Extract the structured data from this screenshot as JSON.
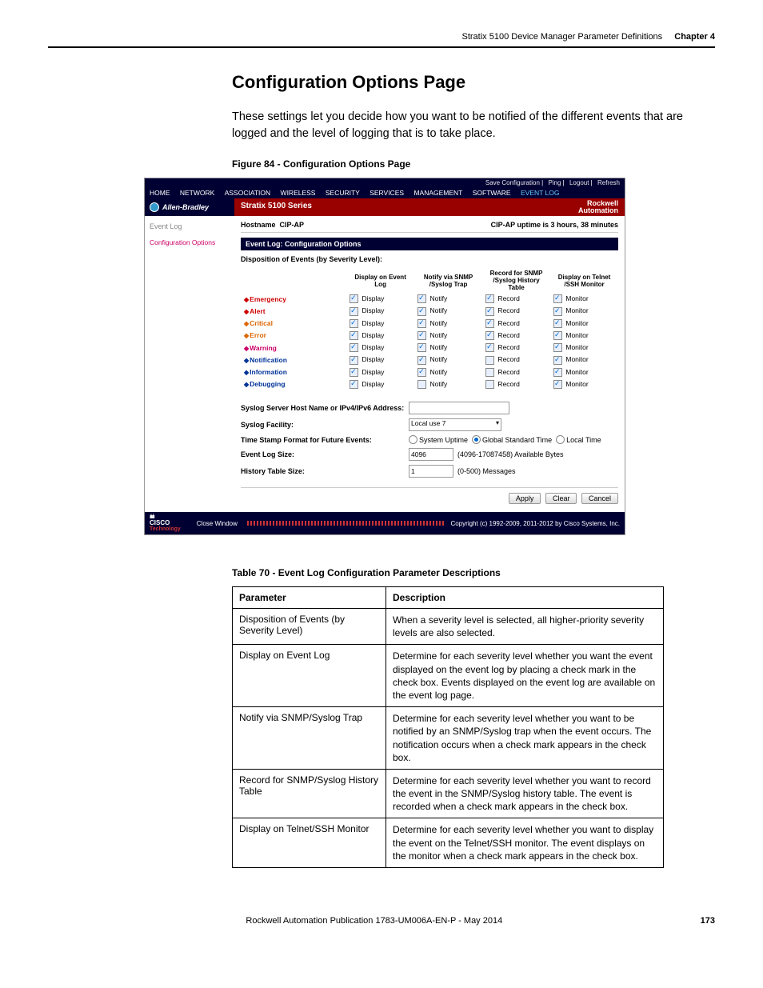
{
  "header": {
    "doc_section": "Stratix 5100 Device Manager Parameter Definitions",
    "chapter": "Chapter 4"
  },
  "section": {
    "title": "Configuration Options Page",
    "body": "These settings let you decide how you want to be notified of the different events that are logged and the level of logging that is to take place.",
    "figure_caption": "Figure 84 - Configuration Options Page",
    "table_caption": "Table 70 - Event Log Configuration Parameter Descriptions"
  },
  "ui": {
    "top_links": [
      "Save Configuration",
      "Ping",
      "Logout",
      "Refresh"
    ],
    "menu": [
      "HOME",
      "NETWORK",
      "ASSOCIATION",
      "WIRELESS",
      "SECURITY",
      "SERVICES",
      "MANAGEMENT",
      "SOFTWARE",
      "EVENT LOG"
    ],
    "menu_active": "EVENT LOG",
    "brand_left": "Allen-Bradley",
    "brand_mid": "Stratix 5100 Series",
    "brand_right1": "Rockwell",
    "brand_right2": "Automation",
    "side1": "Event Log",
    "side2": "Configuration Options",
    "hostname_label": "Hostname",
    "hostname_value": "CIP-AP",
    "uptime": "CIP-AP uptime is 3 hours, 38 minutes",
    "panel_title": "Event Log: Configuration Options",
    "disp_title": "Disposition of Events (by Severity Level):",
    "col1": "Display on Event Log",
    "col2": "Notify via SNMP /Syslog Trap",
    "col3": "Record for SNMP /Syslog History Table",
    "col4": "Display on Telnet /SSH Monitor",
    "lbl_display": "Display",
    "lbl_notify": "Notify",
    "lbl_record": "Record",
    "lbl_monitor": "Monitor",
    "sev": [
      {
        "name": "Emergency",
        "cls": "sev-red",
        "d": true,
        "n": true,
        "r": true,
        "m": true
      },
      {
        "name": "Alert",
        "cls": "sev-red",
        "d": true,
        "n": true,
        "r": true,
        "m": true
      },
      {
        "name": "Critical",
        "cls": "sev-org",
        "d": true,
        "n": true,
        "r": true,
        "m": true
      },
      {
        "name": "Error",
        "cls": "sev-org",
        "d": true,
        "n": true,
        "r": true,
        "m": true
      },
      {
        "name": "Warning",
        "cls": "sev-pnk",
        "d": true,
        "n": true,
        "r": true,
        "m": true
      },
      {
        "name": "Notification",
        "cls": "sev-blu",
        "d": true,
        "n": true,
        "r": false,
        "m": true
      },
      {
        "name": "Information",
        "cls": "sev-blu",
        "d": true,
        "n": true,
        "r": false,
        "m": true
      },
      {
        "name": "Debugging",
        "cls": "sev-blu",
        "d": true,
        "n": false,
        "r": false,
        "m": true
      }
    ],
    "syslog_host_lbl": "Syslog Server Host Name or IPv4/IPv6 Address:",
    "syslog_host_val": "",
    "facility_lbl": "Syslog Facility:",
    "facility_val": "Local use 7",
    "ts_lbl": "Time Stamp Format for Future Events:",
    "ts_opts": {
      "system": "System Uptime",
      "global": "Global Standard Time",
      "local": "Local Time"
    },
    "ts_selected": "global",
    "elsize_lbl": "Event Log Size:",
    "elsize_val": "4096",
    "elsize_range": "(4096-17087458) Available Bytes",
    "hist_lbl": "History Table Size:",
    "hist_val": "1",
    "hist_range": "(0-500) Messages",
    "btn_apply": "Apply",
    "btn_clear": "Clear",
    "btn_cancel": "Cancel",
    "close": "Close Window",
    "copyright": "Copyright (c) 1992-2009, 2011-2012 by Cisco Systems, Inc."
  },
  "params": {
    "h1": "Parameter",
    "h2": "Description",
    "rows": [
      {
        "p": "Disposition of Events (by Severity Level)",
        "d": "When a severity level is selected, all higher-priority severity levels are also selected."
      },
      {
        "p": "Display on Event Log",
        "d": "Determine for each severity level whether you want the event displayed on the event log by placing a check mark in the check box. Events displayed on the event log are available on the event log page."
      },
      {
        "p": "Notify via SNMP/Syslog Trap",
        "d": "Determine for each severity level whether you want to be notified by an SNMP/Syslog trap when the event occurs. The notification occurs when a check mark appears in the check box."
      },
      {
        "p": "Record for SNMP/Syslog History Table",
        "d": "Determine for each severity level whether you want to record the event in the SNMP/Syslog history table. The event is recorded when a check mark appears in the check box."
      },
      {
        "p": "Display on Telnet/SSH Monitor",
        "d": "Determine for each severity level whether you want to display the event on the Telnet/SSH monitor. The event displays on the monitor when a check mark appears in the check box."
      }
    ]
  },
  "footer": {
    "pub": "Rockwell Automation Publication 1783-UM006A-EN-P - May 2014",
    "page": "173"
  }
}
